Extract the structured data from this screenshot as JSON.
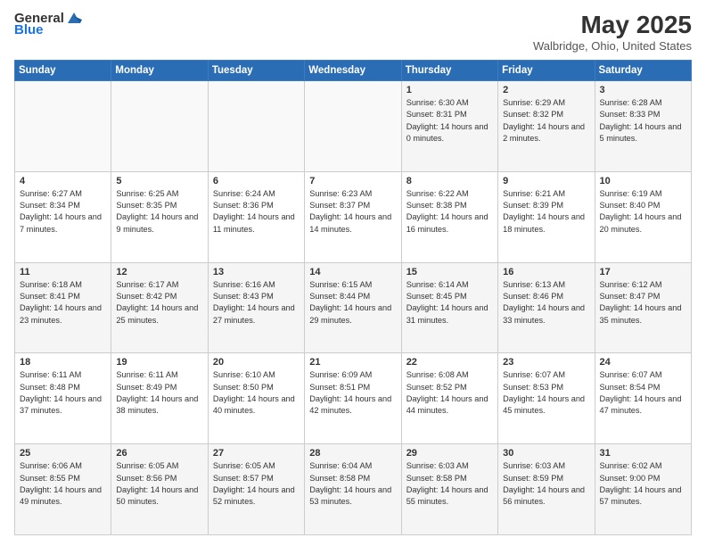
{
  "header": {
    "logo_general": "General",
    "logo_blue": "Blue",
    "title": "May 2025",
    "subtitle": "Walbridge, Ohio, United States"
  },
  "days_of_week": [
    "Sunday",
    "Monday",
    "Tuesday",
    "Wednesday",
    "Thursday",
    "Friday",
    "Saturday"
  ],
  "weeks": [
    [
      {
        "day": "",
        "info": ""
      },
      {
        "day": "",
        "info": ""
      },
      {
        "day": "",
        "info": ""
      },
      {
        "day": "",
        "info": ""
      },
      {
        "day": "1",
        "info": "Sunrise: 6:30 AM\nSunset: 8:31 PM\nDaylight: 14 hours and 0 minutes."
      },
      {
        "day": "2",
        "info": "Sunrise: 6:29 AM\nSunset: 8:32 PM\nDaylight: 14 hours and 2 minutes."
      },
      {
        "day": "3",
        "info": "Sunrise: 6:28 AM\nSunset: 8:33 PM\nDaylight: 14 hours and 5 minutes."
      }
    ],
    [
      {
        "day": "4",
        "info": "Sunrise: 6:27 AM\nSunset: 8:34 PM\nDaylight: 14 hours and 7 minutes."
      },
      {
        "day": "5",
        "info": "Sunrise: 6:25 AM\nSunset: 8:35 PM\nDaylight: 14 hours and 9 minutes."
      },
      {
        "day": "6",
        "info": "Sunrise: 6:24 AM\nSunset: 8:36 PM\nDaylight: 14 hours and 11 minutes."
      },
      {
        "day": "7",
        "info": "Sunrise: 6:23 AM\nSunset: 8:37 PM\nDaylight: 14 hours and 14 minutes."
      },
      {
        "day": "8",
        "info": "Sunrise: 6:22 AM\nSunset: 8:38 PM\nDaylight: 14 hours and 16 minutes."
      },
      {
        "day": "9",
        "info": "Sunrise: 6:21 AM\nSunset: 8:39 PM\nDaylight: 14 hours and 18 minutes."
      },
      {
        "day": "10",
        "info": "Sunrise: 6:19 AM\nSunset: 8:40 PM\nDaylight: 14 hours and 20 minutes."
      }
    ],
    [
      {
        "day": "11",
        "info": "Sunrise: 6:18 AM\nSunset: 8:41 PM\nDaylight: 14 hours and 23 minutes."
      },
      {
        "day": "12",
        "info": "Sunrise: 6:17 AM\nSunset: 8:42 PM\nDaylight: 14 hours and 25 minutes."
      },
      {
        "day": "13",
        "info": "Sunrise: 6:16 AM\nSunset: 8:43 PM\nDaylight: 14 hours and 27 minutes."
      },
      {
        "day": "14",
        "info": "Sunrise: 6:15 AM\nSunset: 8:44 PM\nDaylight: 14 hours and 29 minutes."
      },
      {
        "day": "15",
        "info": "Sunrise: 6:14 AM\nSunset: 8:45 PM\nDaylight: 14 hours and 31 minutes."
      },
      {
        "day": "16",
        "info": "Sunrise: 6:13 AM\nSunset: 8:46 PM\nDaylight: 14 hours and 33 minutes."
      },
      {
        "day": "17",
        "info": "Sunrise: 6:12 AM\nSunset: 8:47 PM\nDaylight: 14 hours and 35 minutes."
      }
    ],
    [
      {
        "day": "18",
        "info": "Sunrise: 6:11 AM\nSunset: 8:48 PM\nDaylight: 14 hours and 37 minutes."
      },
      {
        "day": "19",
        "info": "Sunrise: 6:11 AM\nSunset: 8:49 PM\nDaylight: 14 hours and 38 minutes."
      },
      {
        "day": "20",
        "info": "Sunrise: 6:10 AM\nSunset: 8:50 PM\nDaylight: 14 hours and 40 minutes."
      },
      {
        "day": "21",
        "info": "Sunrise: 6:09 AM\nSunset: 8:51 PM\nDaylight: 14 hours and 42 minutes."
      },
      {
        "day": "22",
        "info": "Sunrise: 6:08 AM\nSunset: 8:52 PM\nDaylight: 14 hours and 44 minutes."
      },
      {
        "day": "23",
        "info": "Sunrise: 6:07 AM\nSunset: 8:53 PM\nDaylight: 14 hours and 45 minutes."
      },
      {
        "day": "24",
        "info": "Sunrise: 6:07 AM\nSunset: 8:54 PM\nDaylight: 14 hours and 47 minutes."
      }
    ],
    [
      {
        "day": "25",
        "info": "Sunrise: 6:06 AM\nSunset: 8:55 PM\nDaylight: 14 hours and 49 minutes."
      },
      {
        "day": "26",
        "info": "Sunrise: 6:05 AM\nSunset: 8:56 PM\nDaylight: 14 hours and 50 minutes."
      },
      {
        "day": "27",
        "info": "Sunrise: 6:05 AM\nSunset: 8:57 PM\nDaylight: 14 hours and 52 minutes."
      },
      {
        "day": "28",
        "info": "Sunrise: 6:04 AM\nSunset: 8:58 PM\nDaylight: 14 hours and 53 minutes."
      },
      {
        "day": "29",
        "info": "Sunrise: 6:03 AM\nSunset: 8:58 PM\nDaylight: 14 hours and 55 minutes."
      },
      {
        "day": "30",
        "info": "Sunrise: 6:03 AM\nSunset: 8:59 PM\nDaylight: 14 hours and 56 minutes."
      },
      {
        "day": "31",
        "info": "Sunrise: 6:02 AM\nSunset: 9:00 PM\nDaylight: 14 hours and 57 minutes."
      }
    ]
  ]
}
